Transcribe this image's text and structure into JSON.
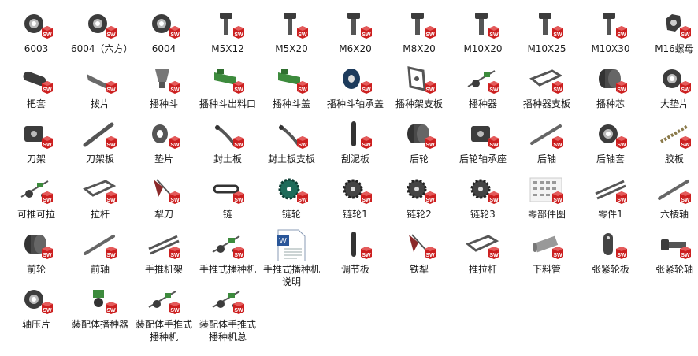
{
  "files": [
    {
      "label": "6003",
      "icon": "bearing-ring"
    },
    {
      "label": "6004（六方）",
      "icon": "bearing-ring"
    },
    {
      "label": "6004",
      "icon": "bearing-ring"
    },
    {
      "label": "M5X12",
      "icon": "bolt"
    },
    {
      "label": "M5X20",
      "icon": "bolt"
    },
    {
      "label": "M6X20",
      "icon": "bolt"
    },
    {
      "label": "M8X20",
      "icon": "bolt"
    },
    {
      "label": "M10X20",
      "icon": "bolt"
    },
    {
      "label": "M10X25",
      "icon": "bolt"
    },
    {
      "label": "M10X30",
      "icon": "bolt"
    },
    {
      "label": "M16螺母",
      "icon": "nut"
    },
    {
      "label": "把套",
      "icon": "grip"
    },
    {
      "label": "拨片",
      "icon": "plate"
    },
    {
      "label": "播种斗",
      "icon": "hopper"
    },
    {
      "label": "播种斗出料口",
      "icon": "green-part"
    },
    {
      "label": "播种斗盖",
      "icon": "green-part"
    },
    {
      "label": "播种斗轴承盖",
      "icon": "ring-blue"
    },
    {
      "label": "播种架支板",
      "icon": "bracket"
    },
    {
      "label": "播种器",
      "icon": "seeder"
    },
    {
      "label": "播种器支板",
      "icon": "frame"
    },
    {
      "label": "播种芯",
      "icon": "cylinder"
    },
    {
      "label": "大垫片",
      "icon": "bearing-ring"
    },
    {
      "label": "刀架",
      "icon": "block"
    },
    {
      "label": "刀架板",
      "icon": "bar"
    },
    {
      "label": "垫片",
      "icon": "washer"
    },
    {
      "label": "封土板",
      "icon": "blade"
    },
    {
      "label": "封土板支板",
      "icon": "blade"
    },
    {
      "label": "刮泥板",
      "icon": "strip"
    },
    {
      "label": "后轮",
      "icon": "cylinder"
    },
    {
      "label": "后轮轴承座",
      "icon": "block"
    },
    {
      "label": "后轴",
      "icon": "rod"
    },
    {
      "label": "后轴套",
      "icon": "bearing-ring"
    },
    {
      "label": "胶板",
      "icon": "spring"
    },
    {
      "label": "可推可拉",
      "icon": "seeder"
    },
    {
      "label": "拉杆",
      "icon": "frame"
    },
    {
      "label": "犁刀",
      "icon": "plow"
    },
    {
      "label": "链",
      "icon": "chain"
    },
    {
      "label": "链轮",
      "icon": "sprocket-green"
    },
    {
      "label": "链轮1",
      "icon": "sprocket"
    },
    {
      "label": "链轮2",
      "icon": "sprocket"
    },
    {
      "label": "链轮3",
      "icon": "sprocket"
    },
    {
      "label": "零部件图",
      "icon": "drawing"
    },
    {
      "label": "零件1",
      "icon": "rods"
    },
    {
      "label": "六棱轴",
      "icon": "rod"
    },
    {
      "label": "前轮",
      "icon": "cylinder"
    },
    {
      "label": "前轴",
      "icon": "rod"
    },
    {
      "label": "手推机架",
      "icon": "rods"
    },
    {
      "label": "手推式播种机",
      "icon": "seeder"
    },
    {
      "label": "手推式播种机说明",
      "icon": "word-doc"
    },
    {
      "label": "调节板",
      "icon": "strip"
    },
    {
      "label": "铁犁",
      "icon": "plow"
    },
    {
      "label": "推拉杆",
      "icon": "frame"
    },
    {
      "label": "下料管",
      "icon": "tube"
    },
    {
      "label": "张紧轮板",
      "icon": "plate-vertical"
    },
    {
      "label": "张紧轮轴",
      "icon": "bolt-horizontal"
    },
    {
      "label": "轴压片",
      "icon": "bearing-ring"
    },
    {
      "label": "装配体播种器",
      "icon": "green-seeder"
    },
    {
      "label": "装配体手推式播种机",
      "icon": "seeder"
    },
    {
      "label": "装配体手推式播种机总",
      "icon": "seeder"
    }
  ],
  "colors": {
    "sw_red": "#cc1f1f",
    "part_dark": "#3c3c3c",
    "part_green": "#3d8b3d",
    "word_blue": "#2a5699"
  }
}
